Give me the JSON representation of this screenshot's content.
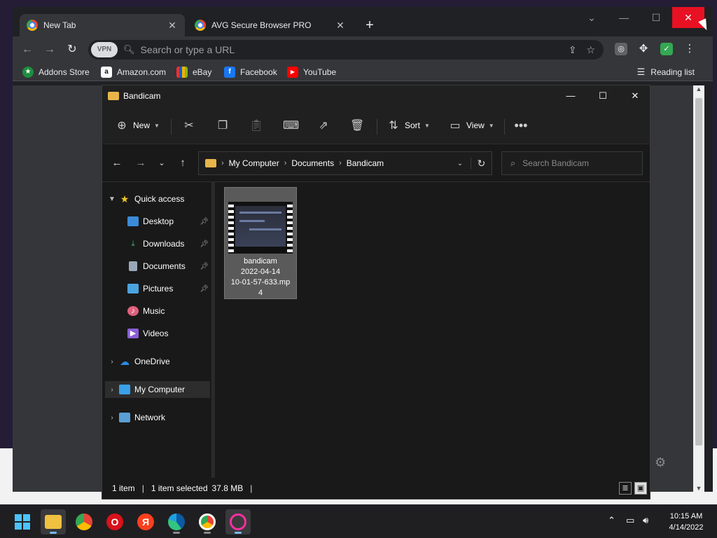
{
  "browser": {
    "tabs": [
      {
        "title": "New Tab",
        "active": true
      },
      {
        "title": "AVG Secure Browser PRO",
        "active": false
      }
    ],
    "vpn_label": "VPN",
    "omnibox_placeholder": "Search or type a URL",
    "bookmarks": [
      {
        "label": "Addons Store",
        "icon": "addons-store-icon",
        "color": "#1e8e3e"
      },
      {
        "label": "Amazon.com",
        "icon": "amazon-icon",
        "color": "#ffffff"
      },
      {
        "label": "eBay",
        "icon": "ebay-icon",
        "color": "#e53238"
      },
      {
        "label": "Facebook",
        "icon": "facebook-icon",
        "color": "#1877f2"
      },
      {
        "label": "YouTube",
        "icon": "youtube-icon",
        "color": "#ff0000"
      }
    ],
    "reading_list": "Reading list"
  },
  "explorer": {
    "title": "Bandicam",
    "commands": {
      "new": "New",
      "sort": "Sort",
      "view": "View"
    },
    "path": [
      "My Computer",
      "Documents",
      "Bandicam"
    ],
    "search_placeholder": "Search Bandicam",
    "nav": {
      "quick_access": "Quick access",
      "items": [
        {
          "label": "Desktop",
          "icon": "desktop-icon",
          "pinned": true
        },
        {
          "label": "Downloads",
          "icon": "downloads-icon",
          "pinned": true
        },
        {
          "label": "Documents",
          "icon": "documents-icon",
          "pinned": true
        },
        {
          "label": "Pictures",
          "icon": "pictures-icon",
          "pinned": true
        },
        {
          "label": "Music",
          "icon": "music-icon",
          "pinned": false
        },
        {
          "label": "Videos",
          "icon": "videos-icon",
          "pinned": false
        }
      ],
      "onedrive": "OneDrive",
      "my_computer": "My Computer",
      "network": "Network"
    },
    "files": [
      {
        "name_line1": "bandicam",
        "name_line2": "2022-04-14",
        "name_line3": "10-01-57-633.mp",
        "name_line4": "4",
        "type": "video-file-icon"
      }
    ],
    "status": {
      "count": "1 item",
      "selected": "1 item selected",
      "size": "37.8 MB"
    }
  },
  "taskbar": {
    "apps": [
      "start-icon",
      "file-explorer-icon",
      "chrome-icon",
      "opera-icon",
      "yandex-icon",
      "edge-icon",
      "avg-browser-icon",
      "opera-gx-icon"
    ],
    "time": "10:15 AM",
    "date": "4/14/2022"
  },
  "colors": {
    "accent": "#76b9ed",
    "close_red": "#e81123",
    "folder": "#e8b54a"
  }
}
